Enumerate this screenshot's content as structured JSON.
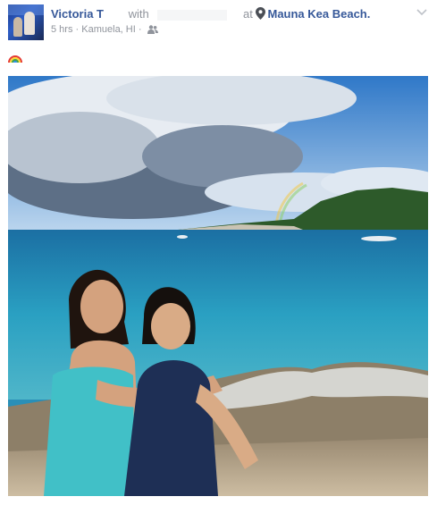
{
  "post": {
    "author": "Victoria T",
    "with_label": "with",
    "at_label": "at",
    "location": "Mauna Kea Beach.",
    "time": "5 hrs",
    "place": "Kamuela, HI",
    "separator": "·",
    "audience_icon": "friends-icon",
    "caption_icon": "rainbow-emoji",
    "options_icon": "chevron-down-icon",
    "photo_icon": "beach-photo"
  },
  "colors": {
    "link": "#365899",
    "muted": "#90949c",
    "text": "#1d2129"
  }
}
